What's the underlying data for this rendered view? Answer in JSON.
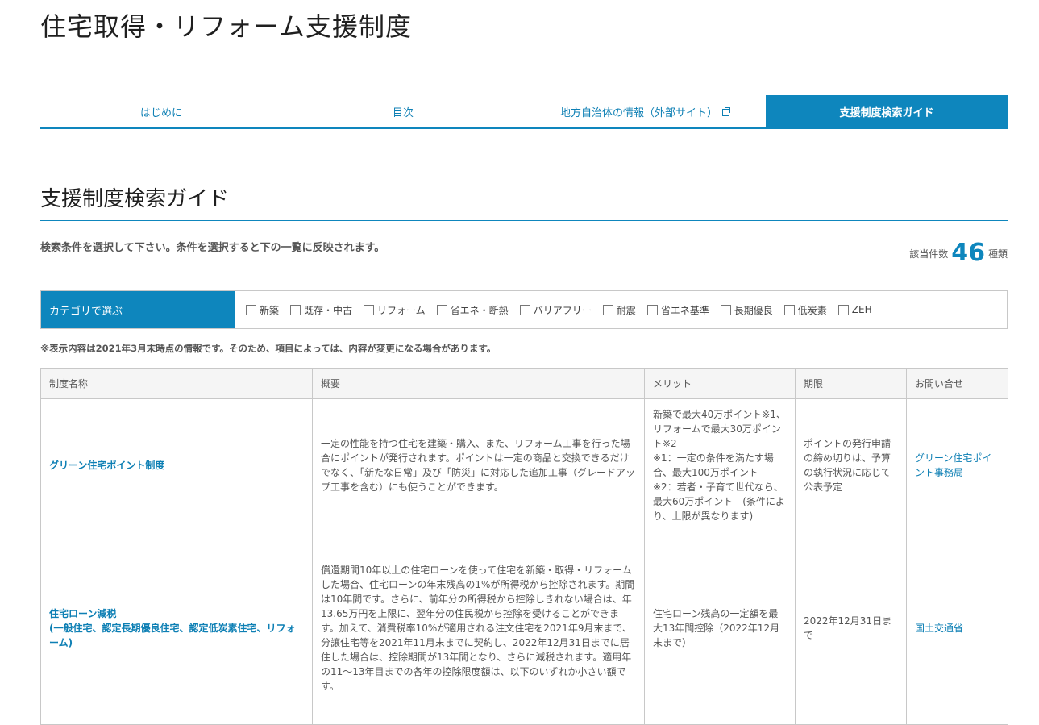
{
  "page_title": "住宅取得・リフォーム支援制度",
  "tabs": [
    {
      "label": "はじめに"
    },
    {
      "label": "目次"
    },
    {
      "label": "地方自治体の情報（外部サイト）",
      "icon": "external-link-icon"
    },
    {
      "label": "支援制度検索ガイド",
      "active": true
    }
  ],
  "section": {
    "title": "支援制度検索ガイド",
    "instruction": "検索条件を選択して下さい。条件を選択すると下の一覧に反映されます。",
    "count_prefix": "該当件数",
    "count_value": "46",
    "count_suffix": "種類"
  },
  "filter": {
    "label": "カテゴリで選ぶ",
    "options": [
      "新築",
      "既存・中古",
      "リフォーム",
      "省エネ・断熱",
      "バリアフリー",
      "耐震",
      "省エネ基準",
      "長期優良",
      "低炭素",
      "ZEH"
    ]
  },
  "note": "※表示内容は2021年3月末時点の情報です。そのため、項目によっては、内容が変更になる場合があります。",
  "table": {
    "headers": [
      "制度名称",
      "概要",
      "メリット",
      "期限",
      "お問い合せ"
    ],
    "rows": [
      {
        "name": "グリーン住宅ポイント制度",
        "summary": "一定の性能を持つ住宅を建築・購入、また、リフォーム工事を行った場合にポイントが発行されます。ポイントは一定の商品と交換できるだけでなく、「新たな日常」及び「防災」に対応した追加工事（グレードアップ工事を含む）にも使うことができます。",
        "merit": "新築で最大40万ポイント※1、リフォームで最大30万ポイント※2\n※1：一定の条件を満たす場合、最大100万ポイント\n※2：若者・子育て世代なら、最大60万ポイント　(条件により、上限が異なります)",
        "deadline": "ポイントの発行申請の締め切りは、予算の執行状況に応じて公表予定",
        "contact": "グリーン住宅ポイント事務局"
      },
      {
        "name": "住宅ローン減税\n(一般住宅、認定長期優良住宅、認定低炭素住宅、リフォーム)",
        "summary": "償還期間10年以上の住宅ローンを使って住宅を新築・取得・リフォームした場合、住宅ローンの年末残高の1%が所得税から控除されます。期間は10年間です。さらに、前年分の所得税から控除しきれない場合は、年13.65万円を上限に、翌年分の住民税から控除を受けることができます。加えて、消費税率10%が適用される注文住宅を2021年9月末まで、分譲住宅等を2021年11月末までに契約し、2022年12月31日までに居住した場合は、控除期間が13年間となり、さらに減税されます。適用年の11〜13年目までの各年の控除限度額は、以下のいずれか小さい額です。",
        "merit": "住宅ローン残高の一定額を最大13年間控除（2022年12月末まで）",
        "deadline": "2022年12月31日まで",
        "contact": "国土交通省"
      }
    ]
  }
}
